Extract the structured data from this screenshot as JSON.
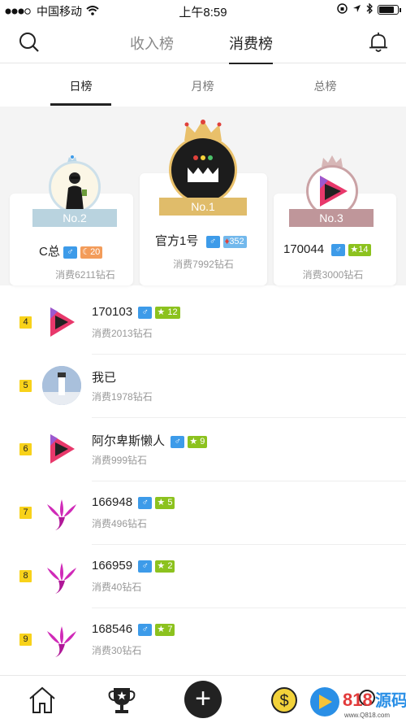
{
  "status_bar": {
    "carrier": "中国移动",
    "time": "上午8:59"
  },
  "top_tabs": [
    {
      "label": "收入榜"
    },
    {
      "label": "消费榜"
    }
  ],
  "sub_tabs": [
    {
      "label": "日榜"
    },
    {
      "label": "月榜"
    },
    {
      "label": "总榜"
    }
  ],
  "podium": [
    {
      "rank_label": "No.2",
      "name": "C总",
      "level": "20",
      "spent": "消费6211钻石"
    },
    {
      "rank_label": "No.1",
      "name": "官方1号",
      "level": "352",
      "spent": "消费7992钻石"
    },
    {
      "rank_label": "No.3",
      "name": "170044",
      "level": "14",
      "spent": "消费3000钻石"
    }
  ],
  "list": [
    {
      "rank": "4",
      "name": "170103",
      "level": "12",
      "spent": "消费2013钻石"
    },
    {
      "rank": "5",
      "name": "我已 ",
      "level": "",
      "spent": "消费1978钻石"
    },
    {
      "rank": "6",
      "name": "阿尔卑斯懒人",
      "level": "9",
      "spent": "消费999钻石"
    },
    {
      "rank": "7",
      "name": "166948",
      "level": "5",
      "spent": "消费496钻石"
    },
    {
      "rank": "8",
      "name": "166959",
      "level": "2",
      "spent": "消费40钻石"
    },
    {
      "rank": "9",
      "name": "168546",
      "level": "7",
      "spent": "消费30钻石"
    }
  ],
  "colors": {
    "accent": "#222222",
    "male_badge": "#3d9be9",
    "level_green": "#8cc21e",
    "level_orange": "#f39c5a",
    "rank_badge": "#f8d21a"
  },
  "watermark": {
    "text": "818源码",
    "sub": "www.Q818.com"
  }
}
